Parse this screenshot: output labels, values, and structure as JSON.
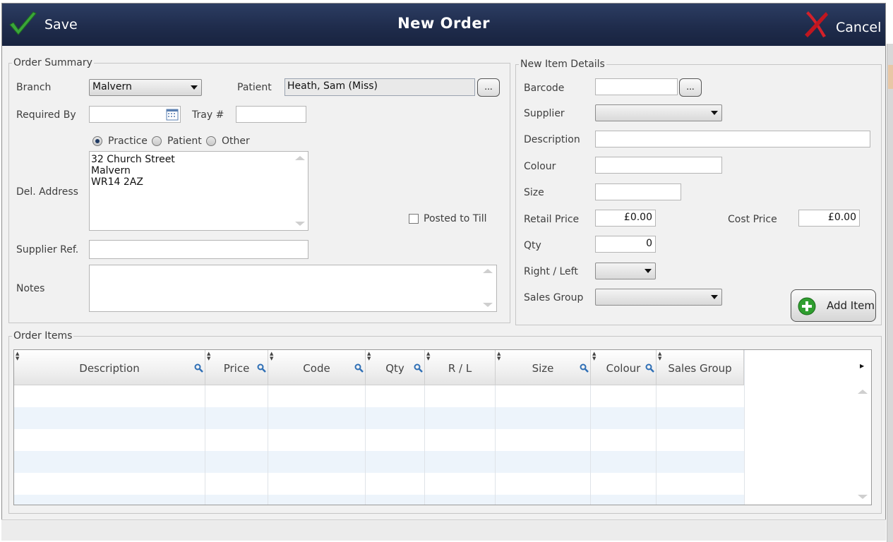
{
  "window": {
    "title": "New Order",
    "save_label": "Save",
    "cancel_label": "Cancel"
  },
  "order_summary": {
    "legend": "Order Summary",
    "branch_label": "Branch",
    "branch_value": "Malvern",
    "patient_label": "Patient",
    "patient_value": "Heath, Sam (Miss)",
    "ellipsis_label": "...",
    "required_by_label": "Required By",
    "required_by_value": "",
    "tray_label": "Tray #",
    "tray_value": "",
    "address_options": [
      "Practice",
      "Patient",
      "Other"
    ],
    "address_selected": "Practice",
    "del_address_label": "Del. Address",
    "del_address_lines": [
      "32 Church Street",
      "Malvern",
      "WR14 2AZ"
    ],
    "posted_to_till_label": "Posted to Till",
    "posted_to_till_checked": false,
    "supplier_ref_label": "Supplier Ref.",
    "supplier_ref_value": "",
    "notes_label": "Notes",
    "notes_value": ""
  },
  "new_item": {
    "legend": "New Item Details",
    "barcode_label": "Barcode",
    "barcode_value": "",
    "ellipsis_label": "...",
    "supplier_label": "Supplier",
    "supplier_value": "",
    "description_label": "Description",
    "description_value": "",
    "colour_label": "Colour",
    "colour_value": "",
    "size_label": "Size",
    "size_value": "",
    "retail_price_label": "Retail Price",
    "retail_price_value": "£0.00",
    "cost_price_label": "Cost Price",
    "cost_price_value": "£0.00",
    "qty_label": "Qty",
    "qty_value": "0",
    "right_left_label": "Right / Left",
    "right_left_value": "",
    "sales_group_label": "Sales Group",
    "sales_group_value": "",
    "add_item_label": "Add Item"
  },
  "order_items": {
    "legend": "Order Items",
    "columns": [
      "Description",
      "Price",
      "Code",
      "Qty",
      "R / L",
      "Size",
      "Colour",
      "Sales Group"
    ],
    "rows": []
  },
  "colors": {
    "titlebar": "#1f2c4c",
    "save_check": "#3aa63a",
    "cancel_x": "#d4202a",
    "add_plus": "#2f9e2f",
    "row_alt": "#edf4fb"
  },
  "icons": {
    "save": "check-icon",
    "cancel": "x-icon",
    "add": "plus-circle-icon",
    "date": "calendar-icon",
    "filter": "magnifier-icon"
  }
}
